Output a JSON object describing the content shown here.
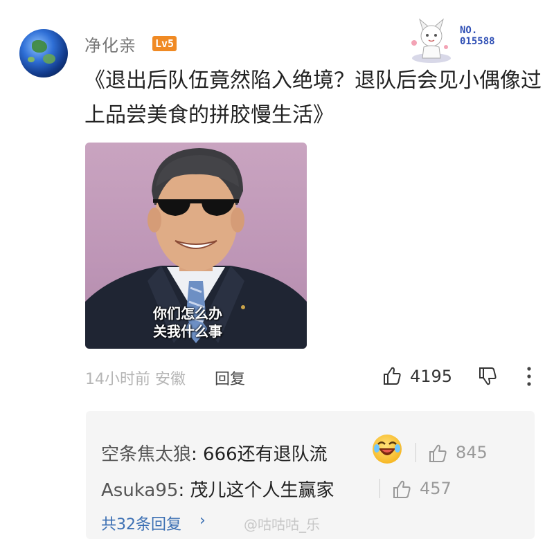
{
  "comment": {
    "user": "净化亲",
    "level": "Lv5",
    "fan_badge": {
      "label": "NO.",
      "number": "015588"
    },
    "text": "《退出后队伍竟然陷入绝境？退队后会见小偶像过上品尝美食的拼胶慢生活》",
    "image_caption": [
      "你们怎么办",
      "关我什么事"
    ],
    "time_location": "14小时前 安徽",
    "reply_label": "回复",
    "like_count": "4195"
  },
  "replies": [
    {
      "name": "空条焦太狼",
      "text": "666还有退队流",
      "likes": "845"
    },
    {
      "name": "Asuka95",
      "text": "茂儿这个人生赢家",
      "likes": "457"
    }
  ],
  "more_replies": "共32条回复",
  "watermark": "@咕咕咕_乐",
  "icons": {
    "like": "thumb-up-icon",
    "dislike": "thumb-down-icon",
    "more": "more-vertical-icon",
    "emoji": "laughing-emoji-icon"
  }
}
